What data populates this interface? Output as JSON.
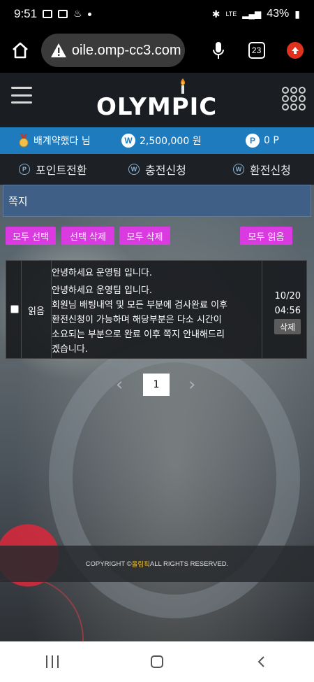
{
  "status_bar": {
    "time": "9:51",
    "network": "LTE",
    "battery": "43%"
  },
  "browser": {
    "url": "oile.omp-cc3.com",
    "tabs_count": "23"
  },
  "site": {
    "logo_text": "OLYMPIC"
  },
  "user_bar": {
    "username": "배계약했다 님",
    "money": "2,500,000 원",
    "money_icon": "W",
    "point": "0 P",
    "point_icon": "P"
  },
  "actions": {
    "point_convert": "포인트전환",
    "deposit": "충전신청",
    "withdraw": "환전신청",
    "point_icon": "P",
    "won_icon": "W"
  },
  "messages": {
    "title": "쪽지",
    "buttons": {
      "select_all": "모두 선택",
      "delete_selected": "선택 삭제",
      "delete_all": "모두 삭제",
      "read_all": "모두 읽음"
    },
    "rows": [
      {
        "status": "읽음",
        "subject": "안녕하세요 운영팀 입니다.",
        "body_line1": "안녕하세요 운영팀 입니다.",
        "body_line2": "회원님 배팅내역 및 모든 부분에 검사완료 이후",
        "body_line3": "환전신청이 가능하며 해당부분은 다소 시간이",
        "body_line4": "소요되는 부분으로 완료 이후 쪽지 안내해드리",
        "body_line5": "겠습니다.",
        "date": "10/20",
        "time": "04:56",
        "delete_label": "삭제"
      }
    ]
  },
  "pagination": {
    "prev": "‹",
    "current": "1",
    "next": "›"
  },
  "footer": {
    "prefix": "COPYRIGHT © ",
    "brand": "올림픽",
    "suffix": " ALL RIGHTS RESERVED."
  },
  "colors": {
    "accent_blue": "#1e7bbd",
    "button_magenta": "#d93be0",
    "header_dark": "#1a1d21"
  }
}
